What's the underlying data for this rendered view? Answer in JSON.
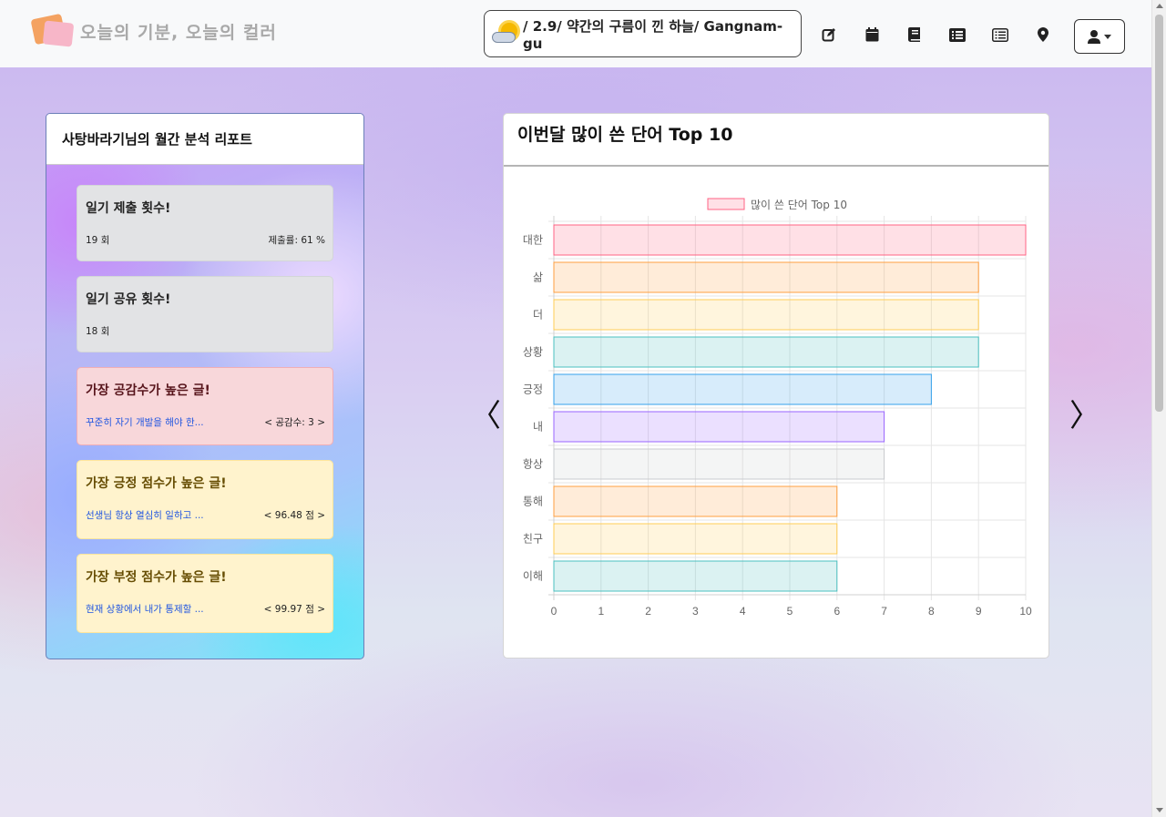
{
  "navbar": {
    "brand": "오늘의 기분, 오늘의 컬러",
    "weather": "/ 2.9/ 약간의 구름이 낀 하늘/ Gangnam-gu",
    "icons": [
      "edit-icon",
      "calendar-icon",
      "book-icon",
      "list-alt-icon",
      "list-icon",
      "map-marker-icon",
      "user-icon"
    ]
  },
  "report": {
    "title": "사탕바라기님의 월간 분석 리포트",
    "submit": {
      "title": "일기 제출 횟수!",
      "count": "19 회",
      "rate": "제출률: 61 %"
    },
    "share": {
      "title": "일기 공유 횟수!",
      "count": "18 회"
    },
    "empathy": {
      "title": "가장 공감수가 높은 글!",
      "link": "꾸준히 자기 개발을 해야 한...",
      "score": "< 공감수: 3 >"
    },
    "positive": {
      "title": "가장 긍정 점수가 높은 글!",
      "link": "선생님 항상 열심히 일하고 ...",
      "score": "< 96.48 점 >"
    },
    "negative": {
      "title": "가장 부정 점수가 높은 글!",
      "link": "현재 상황에서 내가 통제할 ...",
      "score": "< 99.97 점 >"
    }
  },
  "chart": {
    "header": "이번달 많이 쓴 단어 Top 10",
    "prev_arrow": "〈",
    "next_arrow": "〉"
  },
  "chart_data": {
    "type": "bar",
    "orientation": "horizontal",
    "categories": [
      "대한",
      "삶",
      "더",
      "상황",
      "긍정",
      "내",
      "항상",
      "통해",
      "친구",
      "이해"
    ],
    "series": [
      {
        "name": "많이 쓴 단어 Top 10",
        "values": [
          10,
          9,
          9,
          9,
          8,
          7,
          7,
          6,
          6,
          6
        ]
      }
    ],
    "xlim": [
      0,
      10
    ],
    "xticks": [
      "0",
      "1",
      "2",
      "3",
      "4",
      "5",
      "6",
      "7",
      "8",
      "9",
      "10"
    ],
    "grid": true,
    "legend_position": "top",
    "colors": {
      "fill": [
        "rgba(255,99,132,0.2)",
        "rgba(255,159,64,0.2)",
        "rgba(255,205,86,0.2)",
        "rgba(75,192,192,0.2)",
        "rgba(54,162,235,0.2)",
        "rgba(153,102,255,0.2)",
        "rgba(201,203,207,0.2)",
        "rgba(255,159,64,0.2)",
        "rgba(255,205,86,0.2)",
        "rgba(75,192,192,0.2)"
      ],
      "stroke": [
        "#ff6384",
        "#ff9f40",
        "#ffcd56",
        "#4bc0c0",
        "#36a2eb",
        "#9966ff",
        "#c9cbcf",
        "#ff9f40",
        "#ffcd56",
        "#4bc0c0"
      ]
    }
  }
}
